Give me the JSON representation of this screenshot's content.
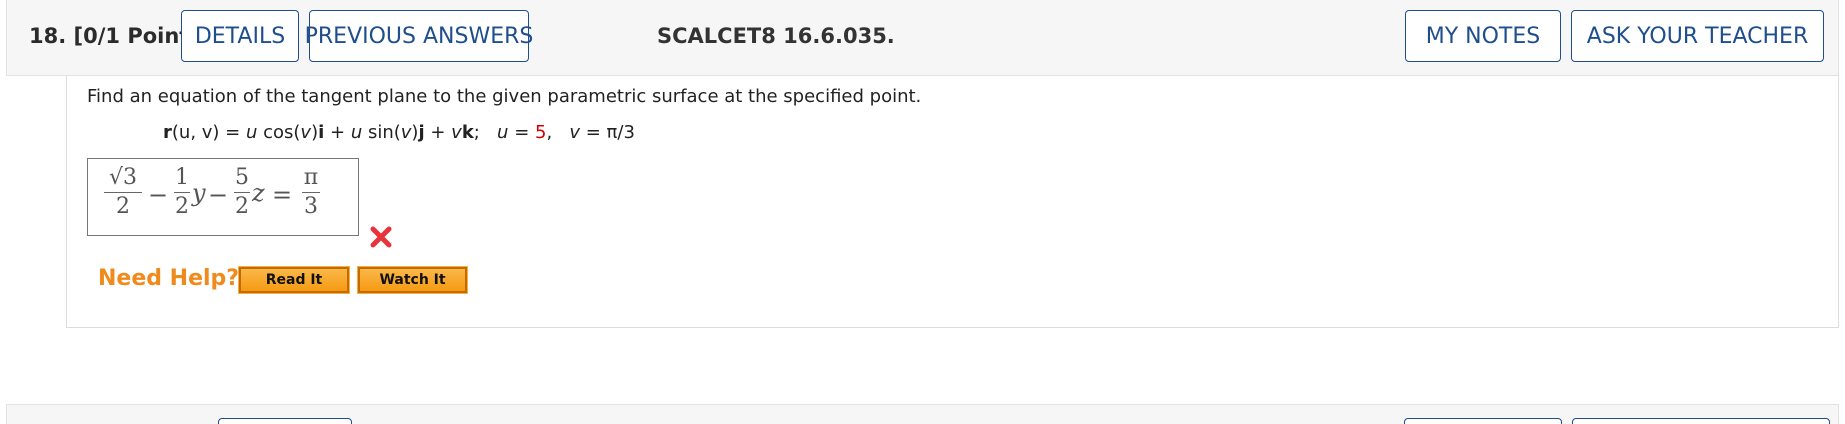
{
  "question": {
    "number_label": "18.",
    "points_label": "[0/1 Points]",
    "code": "SCALCET8 16.6.035."
  },
  "toolbar": {
    "details_label": "DETAILS",
    "previous_answers_label": "PREVIOUS ANSWERS",
    "my_notes_label": "MY NOTES",
    "ask_teacher_label": "ASK YOUR TEACHER"
  },
  "problem": {
    "prompt": "Find an equation of the tangent plane to the given parametric surface at the specified point.",
    "formula": {
      "r": "r",
      "args": "(u, v) = ",
      "u1": "u",
      "cos": " cos(",
      "v1": "v",
      "close_i": ")",
      "i": "i",
      "plus1": " + ",
      "u2": "u",
      "sin": " sin(",
      "v2": "v",
      "close_j": ")",
      "j": "j",
      "plus2": " + ",
      "v3": "v",
      "k": "k",
      "semi": ";",
      "u_eq": "u",
      "eq1": " = ",
      "u_val": "5",
      "comma": ",",
      "v_eq": "v",
      "eq2": " = π/3"
    }
  },
  "answer": {
    "frac1_num": "√3",
    "frac1_den": "2",
    "minus1": "−",
    "frac2_num": "1",
    "frac2_den": "2",
    "var_y": "y",
    "minus2": "−",
    "frac3_num": "5",
    "frac3_den": "2",
    "var_z": "z",
    "equals": "=",
    "frac4_num": "π",
    "frac4_den": "3",
    "status": "incorrect",
    "status_color": "#e8333a"
  },
  "help": {
    "label": "Need Help?",
    "read_it_label": "Read It",
    "watch_it_label": "Watch It",
    "accent_color": "#f08a1c"
  },
  "colors": {
    "link_blue": "#1f4e8c",
    "header_bg": "#f6f6f6",
    "u_value_red": "#d40000"
  }
}
